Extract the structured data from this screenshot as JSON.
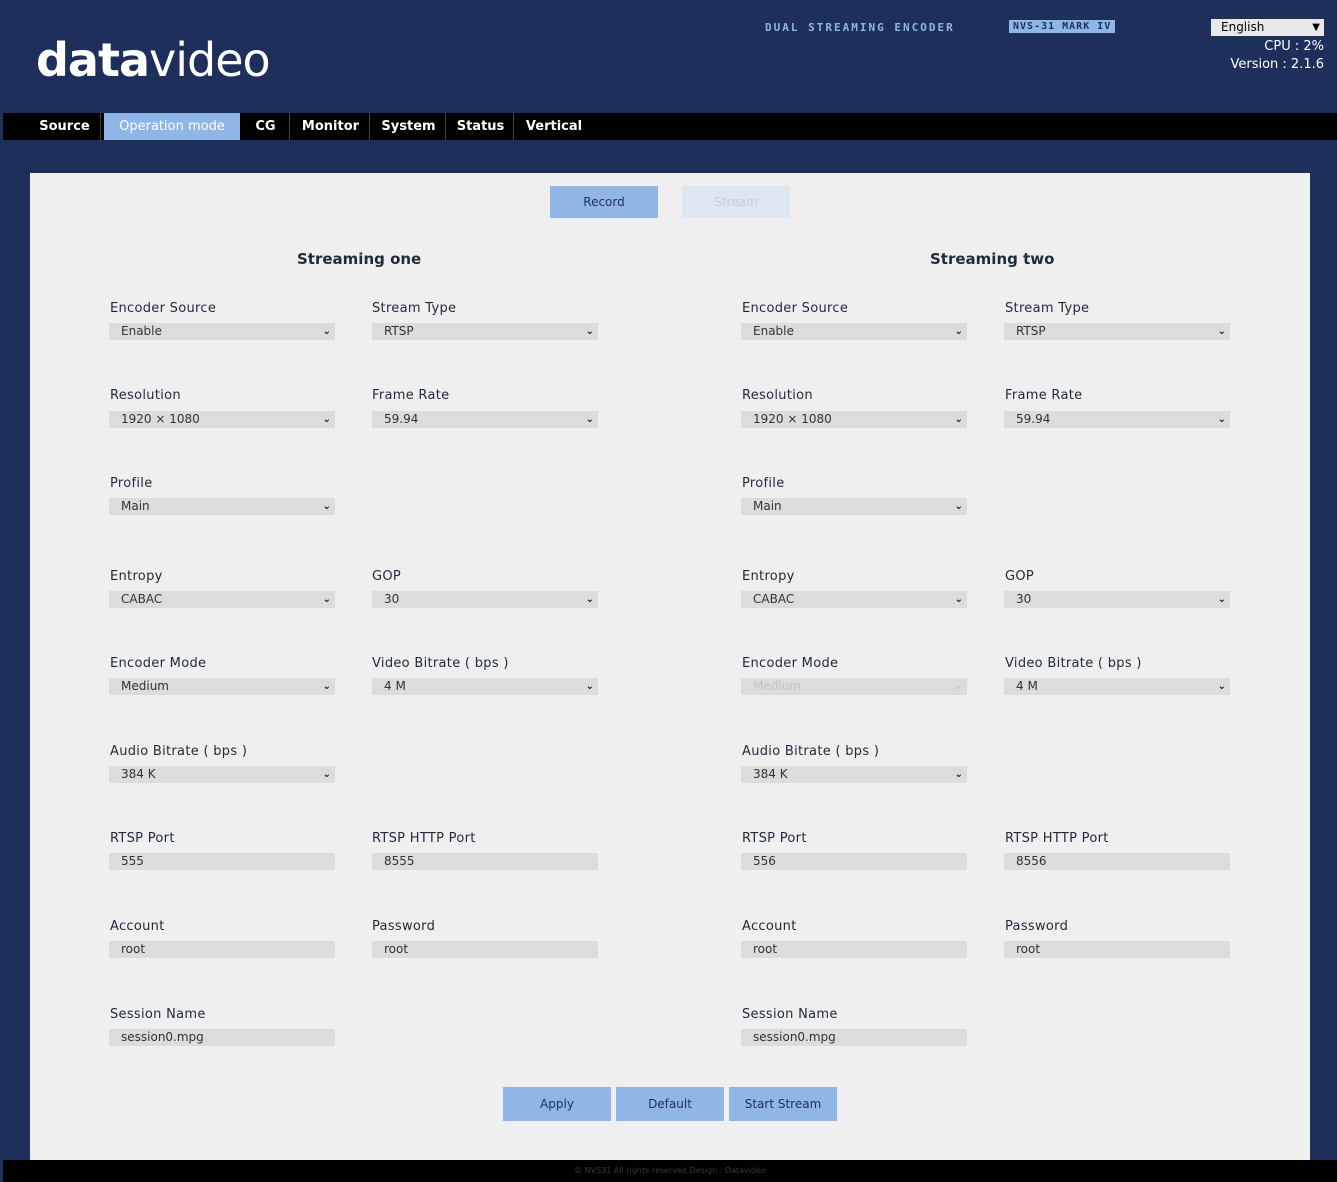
{
  "header": {
    "logo_bold": "data",
    "logo_light": "video",
    "product": "DUAL STREAMING ENCODER",
    "model": "NVS-31 MARK IV",
    "language": "English",
    "cpu": "CPU  : 2%",
    "version": "Version : 2.1.6"
  },
  "nav": {
    "tabs": [
      "Source",
      "Operation mode",
      "CG",
      "Monitor",
      "System",
      "Status",
      "Vertical"
    ],
    "active": "Operation mode"
  },
  "mode": {
    "record": "Record",
    "stream": "Stream"
  },
  "stream1": {
    "title": "Streaming one",
    "fields": {
      "encoder_source": {
        "label": "Encoder Source",
        "value": "Enable"
      },
      "stream_type": {
        "label": "Stream Type",
        "value": "RTSP"
      },
      "resolution": {
        "label": "Resolution",
        "value": "1920 × 1080"
      },
      "frame_rate": {
        "label": "Frame Rate",
        "value": "59.94"
      },
      "profile": {
        "label": "Profile",
        "value": "Main"
      },
      "entropy": {
        "label": "Entropy",
        "value": "CABAC"
      },
      "gop": {
        "label": "GOP",
        "value": "30"
      },
      "encoder_mode": {
        "label": "Encoder Mode",
        "value": "Medium"
      },
      "video_bitrate": {
        "label": "Video Bitrate ( bps )",
        "value": "4 M"
      },
      "audio_bitrate": {
        "label": "Audio Bitrate ( bps )",
        "value": "384 K"
      },
      "rtsp_port": {
        "label": "RTSP Port",
        "value": "555"
      },
      "rtsp_http_port": {
        "label": "RTSP HTTP Port",
        "value": "8555"
      },
      "account": {
        "label": "Account",
        "value": "root"
      },
      "password": {
        "label": "Password",
        "value": "root"
      },
      "session_name": {
        "label": "Session Name",
        "value": "session0.mpg"
      }
    }
  },
  "stream2": {
    "title": "Streaming two",
    "fields": {
      "encoder_source": {
        "label": "Encoder Source",
        "value": "Enable"
      },
      "stream_type": {
        "label": "Stream Type",
        "value": "RTSP"
      },
      "resolution": {
        "label": "Resolution",
        "value": "1920 × 1080"
      },
      "frame_rate": {
        "label": "Frame Rate",
        "value": "59.94"
      },
      "profile": {
        "label": "Profile",
        "value": "Main"
      },
      "entropy": {
        "label": "Entropy",
        "value": "CABAC"
      },
      "gop": {
        "label": "GOP",
        "value": "30"
      },
      "encoder_mode": {
        "label": "Encoder Mode",
        "value": "Medium"
      },
      "video_bitrate": {
        "label": "Video Bitrate ( bps )",
        "value": "4 M"
      },
      "audio_bitrate": {
        "label": "Audio Bitrate ( bps )",
        "value": "384 K"
      },
      "rtsp_port": {
        "label": "RTSP Port",
        "value": "556"
      },
      "rtsp_http_port": {
        "label": "RTSP HTTP Port",
        "value": "8556"
      },
      "account": {
        "label": "Account",
        "value": "root"
      },
      "password": {
        "label": "Password",
        "value": "root"
      },
      "session_name": {
        "label": "Session Name",
        "value": "session0.mpg"
      }
    }
  },
  "actions": {
    "apply": "Apply",
    "default": "Default",
    "start_stream": "Start Stream"
  },
  "footer": "© NVS31 All rights reserved Design : Datavideo",
  "colors": {
    "navy": "#1e2f5c",
    "accent": "#8fb6e6",
    "panel": "#efefef"
  }
}
